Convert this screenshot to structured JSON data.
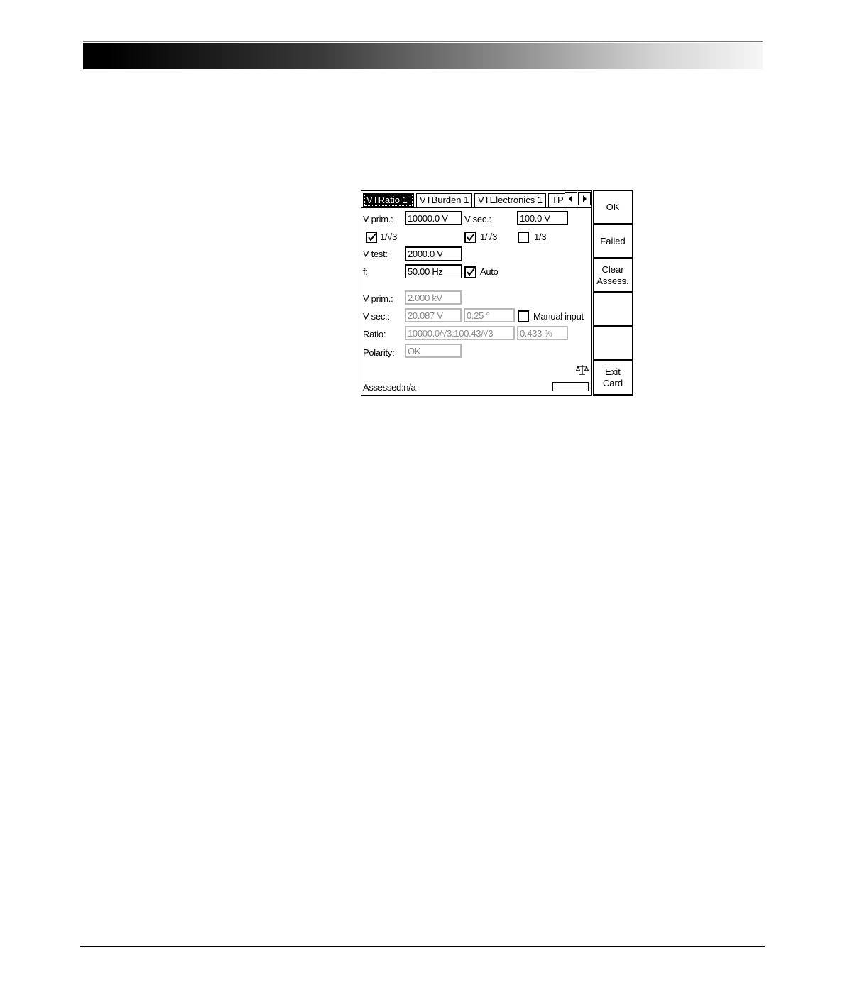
{
  "tabs": [
    {
      "label": "VTRatio 1",
      "active": true
    },
    {
      "label": "VTBurden 1",
      "active": false
    },
    {
      "label": "VTElectronics 1",
      "active": false
    },
    {
      "label": "TP",
      "active": false
    }
  ],
  "tab_nav_icons": [
    "arrow-left-icon",
    "arrow-right-icon"
  ],
  "settings": {
    "vprim_label": "V prim.:",
    "vprim_value": "10000.0 V",
    "vsec_label": "V sec.:",
    "vsec_value": "100.0 V",
    "prim_sqrt3": {
      "label": "1/√3",
      "checked": true
    },
    "sec_sqrt3": {
      "label": "1/√3",
      "checked": true
    },
    "sec_third": {
      "label": "1/3",
      "checked": false
    },
    "vtest_label": "V test:",
    "vtest_value": "2000.0 V",
    "f_label": "f:",
    "f_value": "50.00 Hz",
    "auto": {
      "label": "Auto",
      "checked": true
    }
  },
  "results": {
    "vprim_label": "V prim.:",
    "vprim_value": "2.000 kV",
    "vsec_label": "V sec.:",
    "vsec_value": "20.087 V",
    "vsec_phase": "0.25 °",
    "manual_input": {
      "label": "Manual input",
      "checked": false
    },
    "ratio_label": "Ratio:",
    "ratio_value": "10000.0/√3:100.43/√3",
    "ratio_error": "0.433 %",
    "polarity_label": "Polarity:",
    "polarity_value": "OK"
  },
  "status": {
    "assessed": "Assessed:n/a",
    "icon": "balance-scale-icon"
  },
  "softkeys": [
    {
      "label": "OK"
    },
    {
      "label": "Failed"
    },
    {
      "label": "Clear\nAssess."
    },
    {
      "label": ""
    },
    {
      "label": ""
    },
    {
      "label": "Exit\nCard"
    }
  ]
}
